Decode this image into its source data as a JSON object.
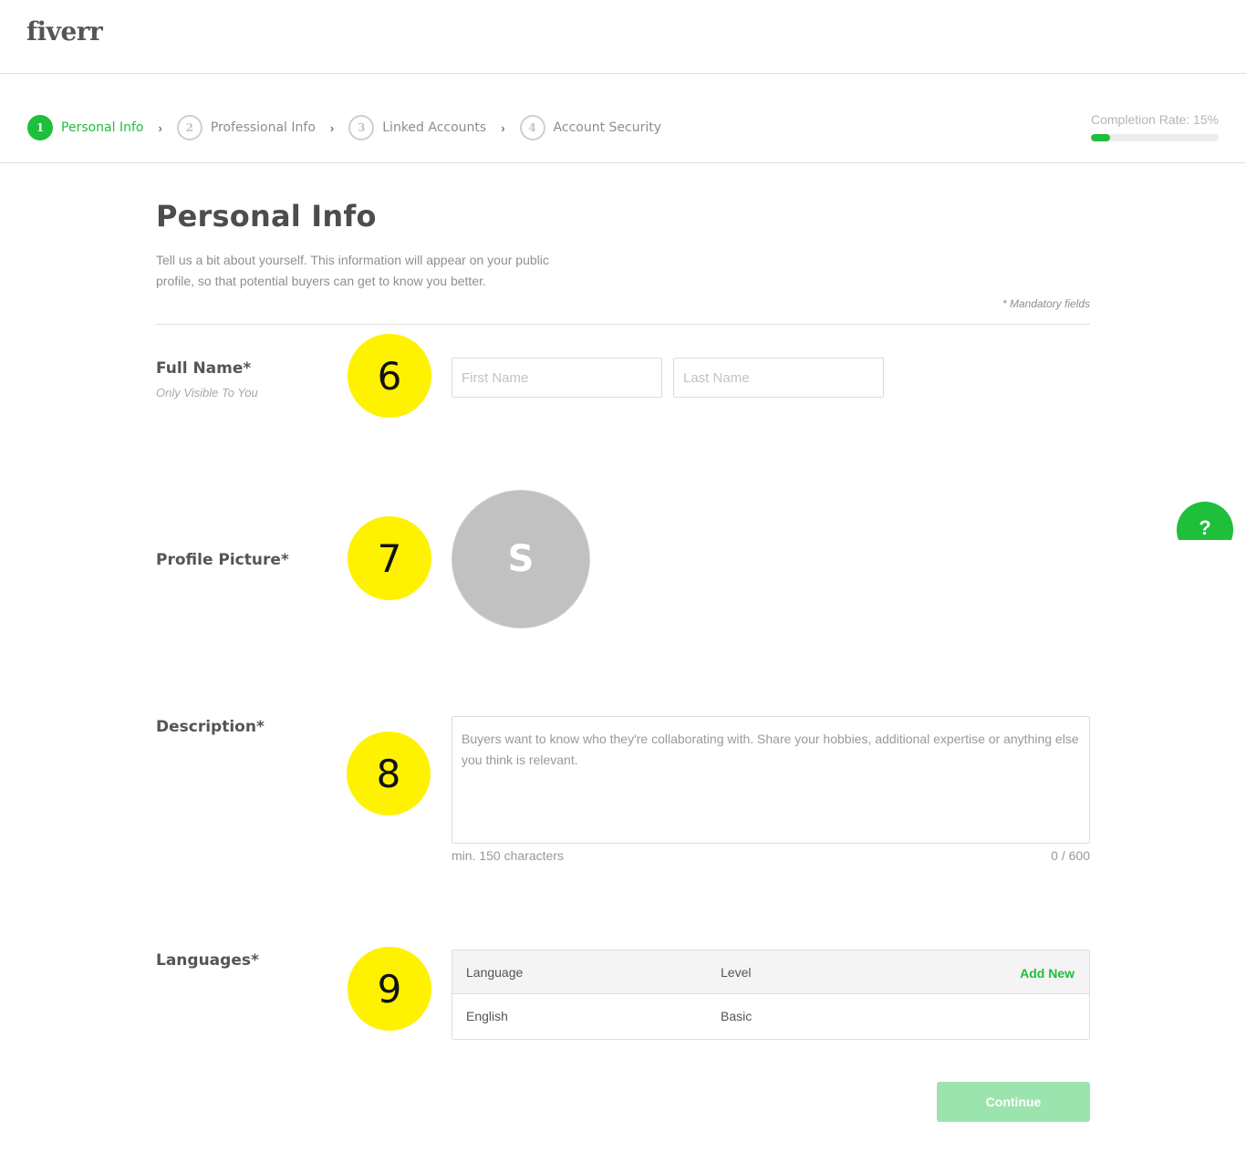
{
  "brand": {
    "logo_text": "fiverr",
    "accent_color": "#1dbf3b"
  },
  "steps": [
    {
      "number": "1",
      "label": "Personal Info",
      "active": true
    },
    {
      "number": "2",
      "label": "Professional Info",
      "active": false
    },
    {
      "number": "3",
      "label": "Linked Accounts",
      "active": false
    },
    {
      "number": "4",
      "label": "Account Security",
      "active": false
    }
  ],
  "step_separator": "›",
  "completion": {
    "label": "Completion Rate: 15%",
    "percent": 15
  },
  "page": {
    "title": "Personal Info",
    "intro": "Tell us a bit about yourself. This information will appear on your public profile, so that potential buyers can get to know you better.",
    "mandatory_note": "* Mandatory fields"
  },
  "full_name": {
    "label": "Full Name*",
    "sublabel": "Only Visible To You",
    "first_name": {
      "value": "",
      "placeholder": "First Name"
    },
    "last_name": {
      "value": "",
      "placeholder": "Last Name"
    }
  },
  "profile_picture": {
    "label": "Profile Picture*",
    "initial": "S"
  },
  "description": {
    "label": "Description*",
    "value": "",
    "placeholder": "Buyers want to know who they're collaborating with. Share your hobbies, additional expertise or anything else you think is relevant.",
    "min_note": "min. 150 characters",
    "counter": "0 / 600"
  },
  "languages": {
    "label": "Languages*",
    "columns": {
      "language": "Language",
      "level": "Level"
    },
    "add_new_label": "Add New",
    "rows": [
      {
        "language": "English",
        "level": "Basic"
      }
    ]
  },
  "annotation_markers": [
    "6",
    "7",
    "8",
    "9"
  ],
  "help_button": {
    "label": "?"
  },
  "continue_label": "Continue"
}
